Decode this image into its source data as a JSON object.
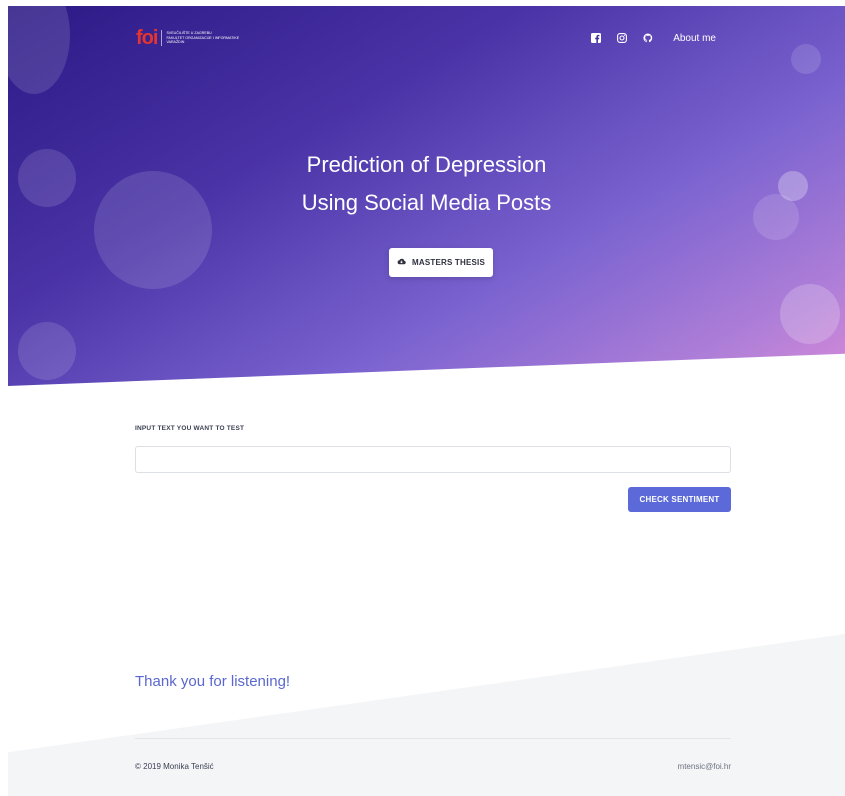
{
  "header": {
    "logo": {
      "mark": "foi",
      "lines": [
        "SVEUČILIŠTE U ZAGREBU",
        "FAKULTET ORGANIZACIJE I INFORMATIKE",
        "VARAŽDIN"
      ]
    },
    "nav": {
      "about_label": "About me",
      "icons": [
        "facebook-icon",
        "instagram-icon",
        "github-icon"
      ]
    }
  },
  "hero": {
    "title_line1": "Prediction of Depression",
    "title_line2": "Using Social Media Posts",
    "button_label": "MASTERS THESIS",
    "button_icon": "cloud-download-icon",
    "gradient_colors": [
      "#2c1985",
      "#4a33a6",
      "#7a63d0",
      "#b07fd8",
      "#d68ad9"
    ]
  },
  "form": {
    "label": "INPUT TEXT YOU WANT TO TEST",
    "input_value": "",
    "input_placeholder": "",
    "submit_label": "CHECK SENTIMENT",
    "accent_color": "#5c6ad9"
  },
  "footer": {
    "heading": "Thank you for listening!",
    "copyright": "© 2019 Monika Tenšić",
    "email": "mtensic@foi.hr"
  }
}
